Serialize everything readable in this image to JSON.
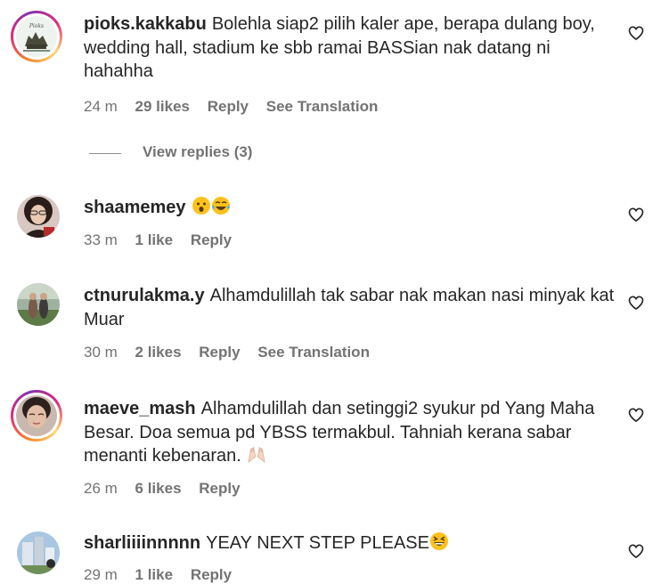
{
  "comments": [
    {
      "username": "pioks.kakkabu",
      "text": "Bolehla siap2 pilih kaler ape, berapa dulang boy, wedding hall, stadium ke sbb ramai BASSian nak datang ni hahahha",
      "time": "24 m",
      "likes": "29 likes",
      "reply": "Reply",
      "translate": "See Translation"
    },
    {
      "username": "shaamemey",
      "text": "",
      "time": "33 m",
      "likes": "1 like",
      "reply": "Reply"
    },
    {
      "username": "ctnurulakma.y",
      "text": "Alhamdulillah tak sabar nak makan nasi minyak kat Muar",
      "time": "30 m",
      "likes": "2 likes",
      "reply": "Reply",
      "translate": "See Translation"
    },
    {
      "username": "maeve_mash",
      "text": "Alhamdulillah dan setinggi2 syukur pd Yang Maha Besar. Doa semua pd YBSS termakbul. Tahniah kerana sabar menanti kebenaran.",
      "time": "26 m",
      "likes": "6 likes",
      "reply": "Reply"
    },
    {
      "username": "sharliiiinnnnn",
      "text": "YEAY NEXT STEP PLEASE",
      "time": "29 m",
      "likes": "1 like",
      "reply": "Reply"
    }
  ],
  "view_replies": "View replies (3)",
  "icons": {
    "heart": "heart-outline-icon",
    "emoji_surprised": "surprised-face-emoji",
    "emoji_tears_joy": "tears-of-joy-emoji",
    "emoji_praying": "praying-hands-emoji",
    "emoji_grin": "grinning-squinting-emoji"
  },
  "colors": {
    "text": "#262626",
    "meta": "#737373",
    "ring_start": "#f58529",
    "ring_mid": "#dd2a7b",
    "ring_end": "#8134af"
  }
}
